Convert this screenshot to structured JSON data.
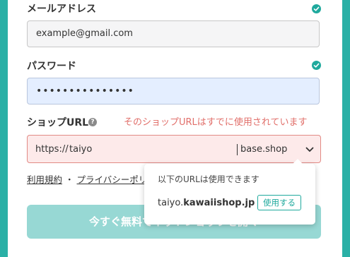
{
  "email": {
    "label": "メールアドレス",
    "value": "example@gmail.com",
    "status_icon": "check-circle-icon"
  },
  "password": {
    "label": "パスワード",
    "value": "•••••••••••••••",
    "status_icon": "check-circle-icon"
  },
  "shop_url": {
    "label": "ショップURL",
    "help_glyph": "?",
    "error": "そのショップURLはすでに使用されています",
    "prefix": "https://",
    "input_value": "taiyo",
    "suffix": "base.shop"
  },
  "terms": {
    "terms_link": "利用規約",
    "separator": "・",
    "privacy_link": "プライバシーポリシ"
  },
  "submit": {
    "label": "今すぐ無料でネットショップを開く"
  },
  "suggestion": {
    "message": "以下のURLは使用できます",
    "domain_sub": "taiyo.",
    "domain_main": "kawaiishop.jp",
    "use_button": "使用する"
  },
  "colors": {
    "accent": "#1fa99d",
    "frame": "#2ab0a6",
    "error": "#e16f6a"
  }
}
